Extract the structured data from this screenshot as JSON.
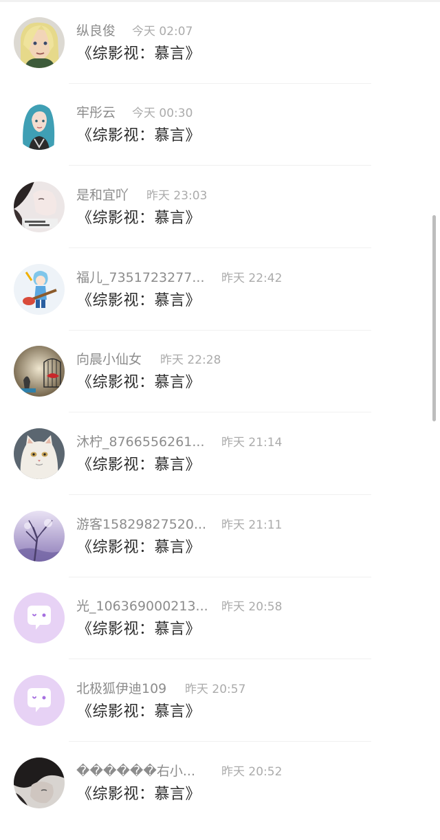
{
  "comments": [
    {
      "user": "纵良俊",
      "time": "今天 02:07",
      "text": "《综影视：慕言》",
      "avatar": "avatar-blonde-anime-icon"
    },
    {
      "user": "牢彤云",
      "time": "今天 00:30",
      "text": "《综影视：慕言》",
      "avatar": "avatar-teal-hair-girl-icon"
    },
    {
      "user": "是和宜吖",
      "time": "昨天 23:03",
      "text": "《综影视：慕言》",
      "avatar": "avatar-photo-girl-icon"
    },
    {
      "user": "福儿_7351723277...",
      "time": "昨天 22:42",
      "text": "《综影视：慕言》",
      "avatar": "avatar-guitar-cartoon-icon"
    },
    {
      "user": "向晨小仙女",
      "time": "昨天 22:28",
      "text": "《综影视：慕言》",
      "avatar": "avatar-birdcage-icon"
    },
    {
      "user": "沐柠_8766556261...",
      "time": "昨天 21:14",
      "text": "《综影视：慕言》",
      "avatar": "avatar-white-cat-icon"
    },
    {
      "user": "游客15829827520...",
      "time": "昨天 21:11",
      "text": "《综影视：慕言》",
      "avatar": "avatar-purple-tree-icon"
    },
    {
      "user": "光_106369000213...",
      "time": "昨天 20:58",
      "text": "《综影视：慕言》",
      "avatar": "avatar-default-chat-icon"
    },
    {
      "user": "北极狐伊迪109",
      "time": "昨天 20:57",
      "text": "《综影视：慕言》",
      "avatar": "avatar-default-chat-icon"
    },
    {
      "user": "������右小...",
      "time": "昨天 20:52",
      "text": "《综影视：慕言》",
      "avatar": "avatar-dark-photo-icon"
    }
  ],
  "colors": {
    "name": "#8c8c8c",
    "time": "#ababab",
    "message": "#2b2b2b",
    "default_avatar_bg": "#e7d2f5",
    "default_avatar_bubble": "#ffffff",
    "default_avatar_accent": "#a670e0"
  }
}
